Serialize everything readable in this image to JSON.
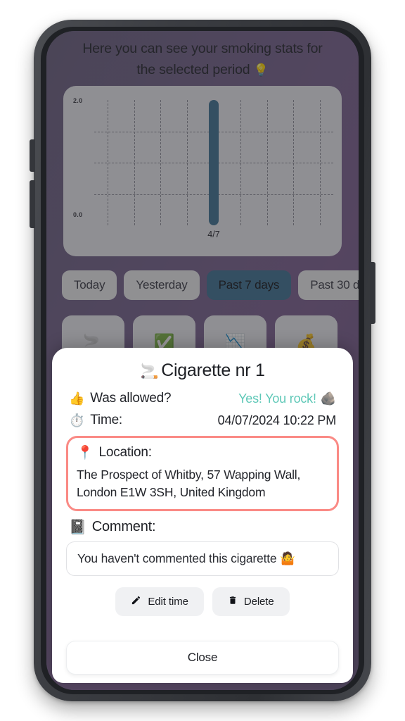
{
  "screen": {
    "hint_line1": "Here you can see your smoking stats for",
    "hint_line2": "the selected period",
    "hint_emoji": "💡"
  },
  "chart_data": {
    "type": "bar",
    "title": "",
    "xlabel": "",
    "ylabel": "",
    "categories": [
      "",
      "",
      "",
      "",
      "4/7",
      "",
      "",
      "",
      ""
    ],
    "values": [
      0,
      0,
      0,
      0,
      2,
      0,
      0,
      0,
      0
    ],
    "ylim": [
      0.0,
      2.0
    ],
    "y_tick_labels": [
      "0.0",
      "2.0"
    ],
    "x_tick_labels": [
      "4/7"
    ],
    "grid": true,
    "legend": "none",
    "bar_color": "#3f7291"
  },
  "period_tabs": [
    {
      "label": "Today",
      "active": false
    },
    {
      "label": "Yesterday",
      "active": false
    },
    {
      "label": "Past 7 days",
      "active": true
    },
    {
      "label": "Past 30 d",
      "active": false
    }
  ],
  "stat_cards": [
    {
      "icon": "🚬"
    },
    {
      "icon": "✅"
    },
    {
      "icon": "📉"
    },
    {
      "icon": "💰"
    }
  ],
  "modal": {
    "title": "Cigarette nr 1",
    "title_icon": "🚬",
    "allowed": {
      "icon": "👍",
      "label": "Was allowed?",
      "value": "Yes! You rock!",
      "value_emoji": "🪨",
      "value_color": "#5ec8b7"
    },
    "time": {
      "icon": "⏱️",
      "label": "Time:",
      "value": "04/07/2024 10:22 PM"
    },
    "location": {
      "icon": "📍",
      "label": "Location:",
      "value": "The Prospect of Whitby, 57 Wapping Wall, London E1W 3SH, United Kingdom",
      "highlight_color": "#fa8a85"
    },
    "comment": {
      "icon": "📓",
      "label": "Comment:",
      "placeholder": "You haven't commented this cigarette 🤷"
    },
    "edit_time_label": "Edit time",
    "delete_label": "Delete",
    "close_label": "Close"
  }
}
